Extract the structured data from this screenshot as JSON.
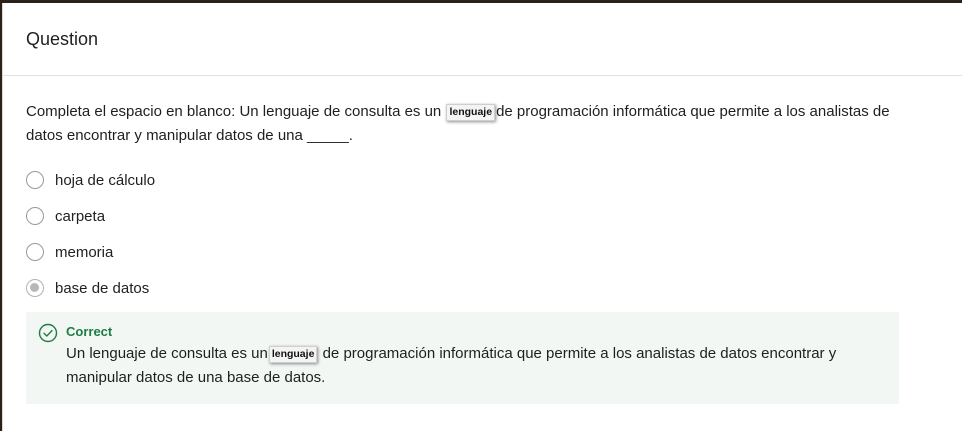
{
  "header": {
    "title": "Question"
  },
  "question": {
    "prefix": "Completa el espacio en blanco: Un lenguaje de consulta es un",
    "tooltip": "lenguaje",
    "suffix": "de programación informática que permite a los analistas de datos encontrar y manipular datos de una _____."
  },
  "options": [
    {
      "label": "hoja de cálculo",
      "selected": false
    },
    {
      "label": "carpeta",
      "selected": false
    },
    {
      "label": "memoria",
      "selected": false
    },
    {
      "label": "base de datos",
      "selected": true
    }
  ],
  "feedback": {
    "status": "Correct",
    "prefix": "Un lenguaje de consulta es un",
    "tooltip": "lenguaje",
    "suffix": "de programación informática que permite a los analistas de datos encontrar y manipular datos de una base de datos.",
    "status_color": "#1e7d45",
    "background": "#f2f7f4"
  },
  "icons": {
    "feedback": "check-circle-icon"
  }
}
